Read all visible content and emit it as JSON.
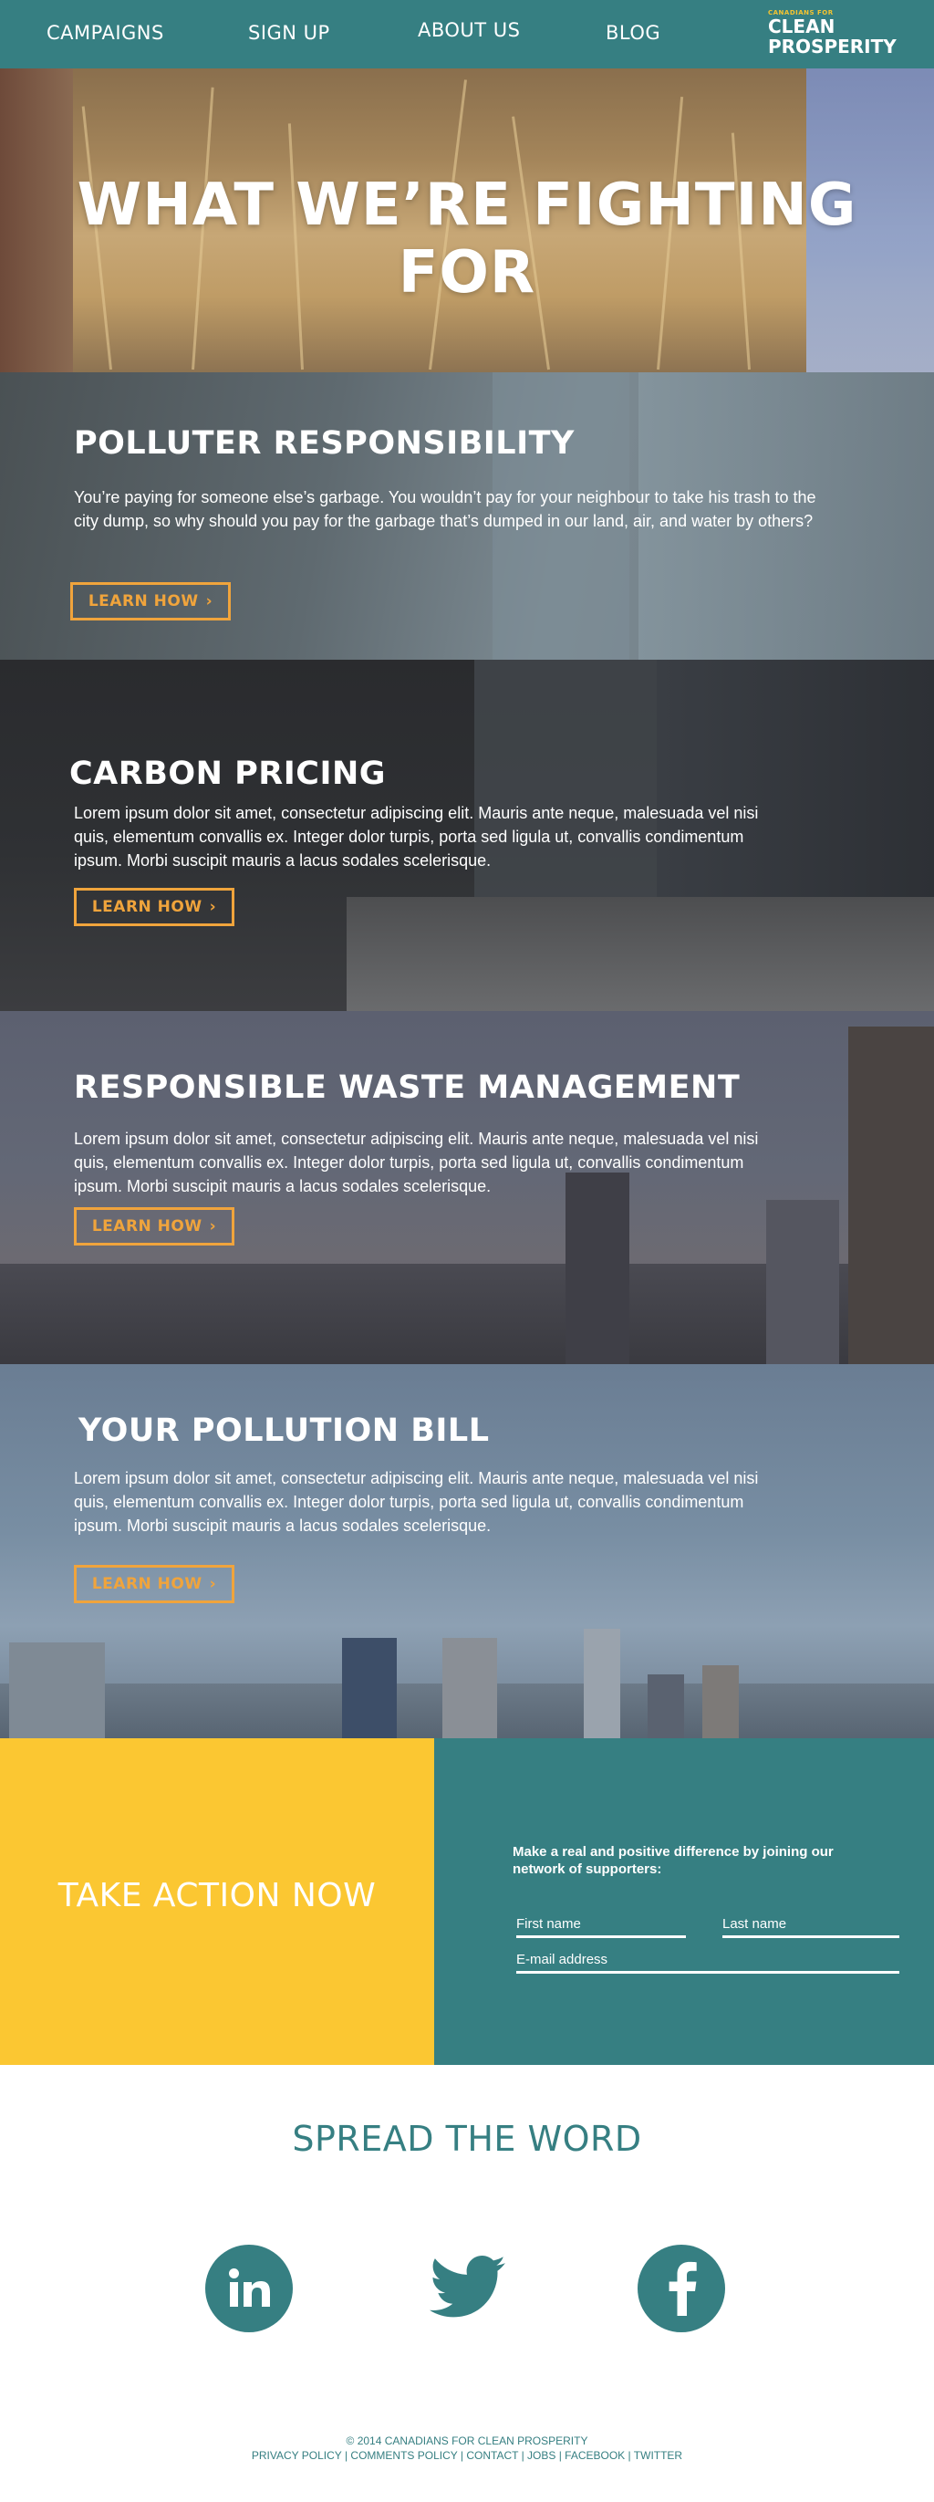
{
  "nav": {
    "links": [
      "CAMPAIGNS",
      "SIGN UP",
      "ABOUT US",
      "BLOG"
    ],
    "logo_small": "CANADIANS FOR",
    "logo_line1": "CLEAN",
    "logo_line2": "PROSPERITY"
  },
  "hero": {
    "title": "WHAT WE’RE FIGHTING FOR"
  },
  "sections": [
    {
      "title": "POLLUTER RESPONSIBILITY",
      "body": "You’re paying for someone else’s garbage. You wouldn’t pay for your neighbour to take his trash to the city dump, so why should you pay for the garbage that’s dumped in our land, air, and water by others?",
      "button": "LEARN HOW"
    },
    {
      "title": "CARBON PRICING",
      "body": "Lorem ipsum dolor sit amet, consectetur adipiscing elit. Mauris ante neque, malesuada vel nisi quis, elementum convallis ex. Integer dolor turpis, porta sed ligula ut, convallis condimentum ipsum. Morbi suscipit mauris a lacus sodales scelerisque.",
      "button": "LEARN HOW"
    },
    {
      "title": "RESPONSIBLE WASTE MANAGEMENT",
      "body": "Lorem ipsum dolor sit amet, consectetur adipiscing elit. Mauris ante neque, malesuada vel nisi quis, elementum convallis ex. Integer dolor turpis, porta sed ligula ut, convallis condimentum ipsum. Morbi suscipit mauris a lacus sodales scelerisque.",
      "button": "LEARN HOW"
    },
    {
      "title": "YOUR POLLUTION BILL",
      "body": "Lorem ipsum dolor sit amet, consectetur adipiscing elit. Mauris ante neque, malesuada vel nisi quis, elementum convallis ex. Integer dolor turpis, porta sed ligula ut, convallis condimentum ipsum. Morbi suscipit mauris a lacus sodales scelerisque.",
      "button": "LEARN HOW"
    }
  ],
  "action": {
    "title": "TAKE ACTION NOW",
    "lead": "Make a real and positive difference by joining our network of supporters:",
    "first_name_placeholder": "First name",
    "last_name_placeholder": "Last name",
    "email_placeholder": "E-mail address"
  },
  "spread": {
    "title": "SPREAD THE WORD",
    "icons": [
      "linkedin-icon",
      "twitter-icon",
      "facebook-icon"
    ]
  },
  "footer": {
    "copyright": "© 2014 CANADIANS FOR CLEAN PROSPERITY",
    "links": [
      "PRIVACY POLICY",
      "COMMENTS POLICY",
      "CONTACT",
      "JOBS",
      "FACEBOOK",
      "TWITTER"
    ]
  },
  "colors": {
    "teal": "#367f82",
    "yellow": "#fbc732",
    "orange_button": "#f0a43c",
    "logo_accent": "#f5c430"
  }
}
